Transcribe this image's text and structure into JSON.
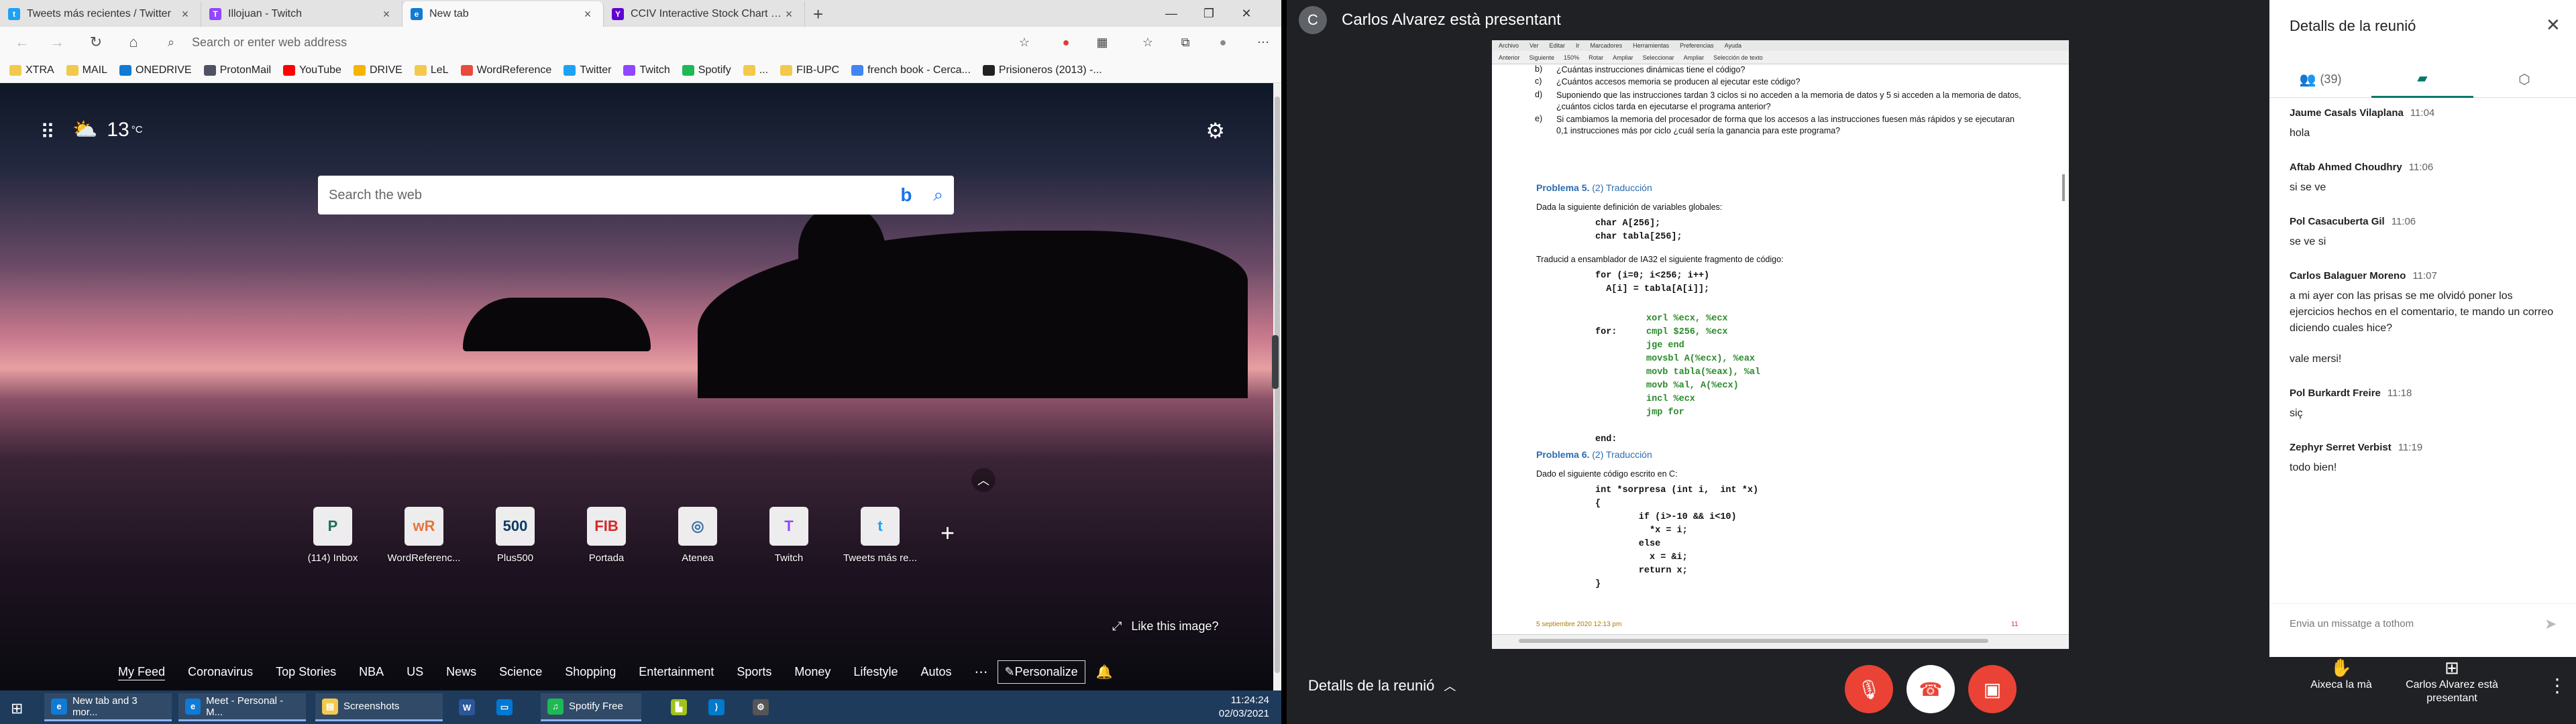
{
  "browser": {
    "tabs": [
      {
        "title": "Tweets más recientes / Twitter",
        "icon": "twitter-icon",
        "color": "#1da1f2",
        "glyph": "t"
      },
      {
        "title": "Illojuan - Twitch",
        "icon": "twitch-icon",
        "color": "#9146ff",
        "glyph": "T"
      },
      {
        "title": "New tab",
        "icon": "edge-icon",
        "color": "#0f7bd4",
        "glyph": "e"
      },
      {
        "title": "CCIV Interactive Stock Chart | Ch",
        "icon": "yahoo-icon",
        "color": "#6001d2",
        "glyph": "Y"
      }
    ],
    "address_placeholder": "Search or enter web address",
    "bookmarks": [
      {
        "label": "XTRA",
        "color": "#f2c94c"
      },
      {
        "label": "MAIL",
        "color": "#f2c94c"
      },
      {
        "label": "ONEDRIVE",
        "color": "#0f7bd4"
      },
      {
        "label": "ProtonMail",
        "color": "#505264"
      },
      {
        "label": "YouTube",
        "color": "#ff0000"
      },
      {
        "label": "DRIVE",
        "color": "#f4b400"
      },
      {
        "label": "LeL",
        "color": "#f2c94c"
      },
      {
        "label": "WordReference",
        "color": "#e84c3d"
      },
      {
        "label": "Twitter",
        "color": "#1da1f2"
      },
      {
        "label": "Twitch",
        "color": "#9146ff"
      },
      {
        "label": "Spotify",
        "color": "#1db954"
      },
      {
        "label": "...",
        "color": "#f2c94c"
      },
      {
        "label": "FIB-UPC",
        "color": "#f2c94c"
      },
      {
        "label": "french book - Cerca...",
        "color": "#4285f4"
      },
      {
        "label": "Prisioneros (2013) -...",
        "color": "#222"
      }
    ]
  },
  "ntp": {
    "temperature": "13",
    "temp_unit": "°C",
    "search_placeholder": "Search the web",
    "bing_glyph": "b",
    "tiles": [
      {
        "label": "(114) Inbox",
        "glyph": "P",
        "color": "#1e6f5c"
      },
      {
        "label": "WordReferenc...",
        "glyph": "wR",
        "color": "#e8743b"
      },
      {
        "label": "Plus500",
        "glyph": "500",
        "color": "#0d3b66"
      },
      {
        "label": "Portada",
        "glyph": "FIB",
        "color": "#d62828"
      },
      {
        "label": "Atenea",
        "glyph": "◎",
        "color": "#3a6ea5"
      },
      {
        "label": "Twitch",
        "glyph": "T",
        "color": "#9146ff"
      },
      {
        "label": "Tweets más re...",
        "glyph": "t",
        "color": "#1da1f2"
      }
    ],
    "like_image": "Like this image?",
    "feed": [
      "My Feed",
      "Coronavirus",
      "Top Stories",
      "NBA",
      "US",
      "News",
      "Science",
      "Shopping",
      "Entertainment",
      "Sports",
      "Money",
      "Lifestyle",
      "Autos"
    ],
    "personalize": "Personalize"
  },
  "taskbar": {
    "items": [
      {
        "label": "New tab and 3 mor...",
        "color": "#0f7bd4",
        "glyph": "e"
      },
      {
        "label": "Meet - Personal - M...",
        "color": "#0f7bd4",
        "glyph": "e"
      },
      {
        "label": "Screenshots",
        "color": "#f2c94c",
        "glyph": "▤"
      },
      {
        "label": "",
        "color": "#2b579a",
        "glyph": "W"
      },
      {
        "label": "",
        "color": "#0078d4",
        "glyph": "▭"
      },
      {
        "label": "Spotify Free",
        "color": "#1db954",
        "glyph": "♫"
      },
      {
        "label": "",
        "color": "#a2c21c",
        "glyph": "▙"
      },
      {
        "label": "",
        "color": "#007acc",
        "glyph": "⟩"
      },
      {
        "label": "",
        "color": "#555",
        "glyph": "⚙"
      }
    ],
    "time": "11:24:24",
    "date": "02/03/2021"
  },
  "meet": {
    "presenter_initial": "C",
    "presenter_text": "Carlos Alvarez està presentant",
    "details_label": "Detalls de la reunió",
    "raise_hand": "Aixeca la mà",
    "presenting": "Carlos Alvarez està presentant",
    "panel": {
      "title": "Detalls de la reunió",
      "people_count": "(39)",
      "chat_placeholder": "Envia un missatge a tothom",
      "messages": [
        {
          "name": "Jaume Casals Vilaplana",
          "time": "11:04",
          "lines": [
            "hola"
          ]
        },
        {
          "name": "Aftab Ahmed Choudhry",
          "time": "11:06",
          "lines": [
            "si se ve"
          ]
        },
        {
          "name": "Pol Casacuberta Gil",
          "time": "11:06",
          "lines": [
            "se ve si"
          ]
        },
        {
          "name": "Carlos Balaguer Moreno",
          "time": "11:07",
          "lines": [
            "a mi ayer con las prisas se me olvidó poner los ejercicios hechos en el comentario, te mando un correo diciendo cuales hice?",
            "vale mersi!"
          ]
        },
        {
          "name": "Pol Burkardt Freire",
          "time": "11:18",
          "lines": [
            "siç"
          ]
        },
        {
          "name": "Zephyr Serret Verbist",
          "time": "11:19",
          "lines": [
            "todo bien!"
          ]
        }
      ]
    },
    "pdf": {
      "menu": [
        "Archivo",
        "Ver",
        "Editar",
        "Ir",
        "Marcadores",
        "Herramientas",
        "Preferencias",
        "Ayuda"
      ],
      "toolbar": [
        "Anterior",
        "Siguiente",
        "150%",
        "Rotar",
        "Ampliar",
        "Seleccionar",
        "Ampliar",
        "Selección de texto"
      ],
      "questions": [
        {
          "label": "b)",
          "text": "¿Cuántas instrucciones dinámicas tiene el código?"
        },
        {
          "label": "c)",
          "text": "¿Cuántos accesos memoria se producen al ejecutar este código?"
        },
        {
          "label": "d)",
          "text": "Suponiendo que las instrucciones tardan 3 ciclos si no acceden a la memoria de datos y 5 si acceden a la memoria de datos, ¿cuántos ciclos tarda en ejecutarse el programa anterior?"
        },
        {
          "label": "e)",
          "text": "Si cambiamos la memoria del procesador de forma que los accesos a las instrucciones fuesen más rápidos y se ejecutaran 0,1 instrucciones más por ciclo ¿cuál sería la ganancia para este programa?"
        }
      ],
      "p5_title": "Problema 5.",
      "p5_tr": "(2) Traducción",
      "p5_intro": "Dada la siguiente definición de variables globales:",
      "p5_decl": "char A[256];\nchar tabla[256];",
      "p5_task": "Traducid a ensamblador de IA32 el siguiente fragmento de código:",
      "p5_c": "for (i=0; i<256; i++)\n  A[i] = tabla[A[i]];",
      "p5_labels": "\nfor:\n\n\n\n\n\n\n\nend:",
      "p5_asm": "xorl %ecx, %ecx\ncmpl $256, %ecx\njge end\nmovsbl A(%ecx), %eax\nmovb tabla(%eax), %al\nmovb %al, A(%ecx)\nincl %ecx\njmp for",
      "p6_title": "Problema 6.",
      "p6_tr": "(2) Traducción",
      "p6_intro": "Dado el siguiente código escrito en C:",
      "p6_code": "int *sorpresa (int i,  int *x)\n{\n        if (i>-10 && i<10)\n          *x = i;\n        else\n          x = &i;\n        return x;\n}",
      "footer_date": "5 septiembre 2020 12:13 pm",
      "page_num": "11"
    }
  }
}
